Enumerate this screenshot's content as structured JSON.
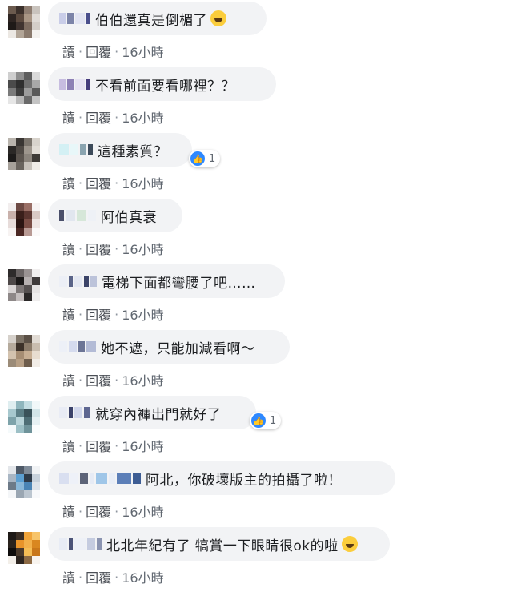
{
  "action_labels": {
    "read": "讀",
    "reply": "回覆",
    "separator": "·"
  },
  "reaction_icon": "like-icon",
  "comments": [
    {
      "text": "伯伯還真是倒楣了",
      "emoji": "grinning-sweat-emoji",
      "time": "16小時",
      "reaction_count": ""
    },
    {
      "text": "不看前面要看哪裡？？",
      "time": "16小時",
      "reaction_count": ""
    },
    {
      "text": "這種素質？",
      "time": "16小時",
      "reaction_count": "1"
    },
    {
      "text": "阿伯真衰",
      "time": "16小時",
      "reaction_count": ""
    },
    {
      "text": "電梯下面都彎腰了吧……",
      "time": "16小時",
      "reaction_count": ""
    },
    {
      "text": "她不遮，只能加減看啊～",
      "time": "16小時",
      "reaction_count": ""
    },
    {
      "text": "就穿內褲出門就好了",
      "time": "16小時",
      "reaction_count": "1"
    },
    {
      "text": "阿北，你破壞版主的拍攝了啦！",
      "time": "16小時",
      "reaction_count": ""
    },
    {
      "text": "北北年紀有了 犒賞一下眼睛很ok的啦",
      "emoji": "rofl-emoji",
      "time": "16小時",
      "reaction_count": ""
    }
  ]
}
